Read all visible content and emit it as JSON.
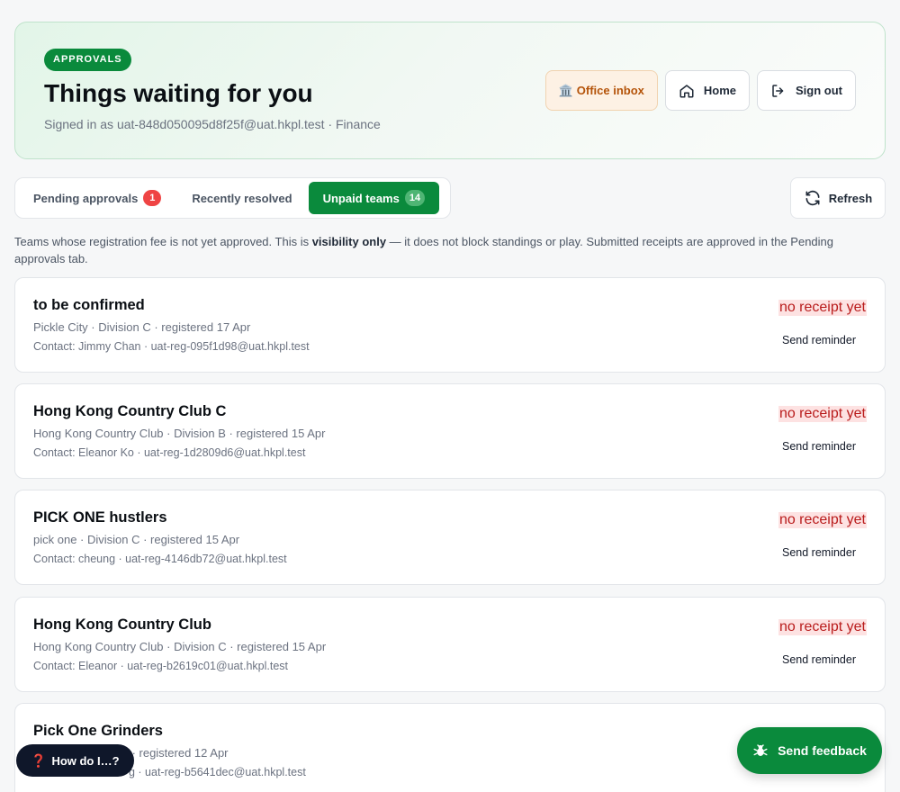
{
  "header": {
    "badge": "APPROVALS",
    "title": "Things waiting for you",
    "signed_in": "Signed in as uat-848d050095d8f25f@uat.hkpl.test · Finance",
    "actions": {
      "office_inbox": "Office inbox",
      "office_icon": "🏛️",
      "home": "Home",
      "sign_out": "Sign out"
    }
  },
  "tabs": [
    {
      "label": "Pending approvals",
      "count": "1"
    },
    {
      "label": "Recently resolved",
      "count": ""
    },
    {
      "label": "Unpaid teams",
      "count": "14",
      "active": true
    }
  ],
  "refresh_label": "Refresh",
  "note": {
    "before": "Teams whose registration fee is not yet approved. This is ",
    "bold": "visibility only",
    "after": " — it does not block standings or play. Submitted receipts are approved in the Pending approvals tab."
  },
  "teams": [
    {
      "name": "to be confirmed",
      "meta": "Pickle City · Division C · registered 17 Apr",
      "contact": "Contact: Jimmy Chan · uat-reg-095f1d98@uat.hkpl.test",
      "status": "no receipt yet",
      "action": "Send reminder"
    },
    {
      "name": "Hong Kong Country Club C",
      "meta": "Hong Kong Country Club · Division B · registered 15 Apr",
      "contact": "Contact: Eleanor Ko · uat-reg-1d2809d6@uat.hkpl.test",
      "status": "no receipt yet",
      "action": "Send reminder"
    },
    {
      "name": "PICK ONE hustlers",
      "meta": "pick one · Division C · registered 15 Apr",
      "contact": "Contact: cheung · uat-reg-4146db72@uat.hkpl.test",
      "status": "no receipt yet",
      "action": "Send reminder"
    },
    {
      "name": "Hong Kong Country Club",
      "meta": "Hong Kong Country Club · Division C · registered 15 Apr",
      "contact": "Contact: Eleanor · uat-reg-b2619c01@uat.hkpl.test",
      "status": "no receipt yet",
      "action": "Send reminder"
    },
    {
      "name": "Pick One Grinders",
      "meta": "A · registered 12 Apr",
      "contact": "g · uat-reg-b5641dec@uat.hkpl.test",
      "status": "",
      "action": ""
    }
  ],
  "floating": {
    "help_icon": "❓",
    "help": "How do I…?",
    "feedback": "Send feedback"
  },
  "colors": {
    "brand_green": "#0a8a3c",
    "status_red": "#b91c1c",
    "status_red_bg": "#fde2e2"
  }
}
